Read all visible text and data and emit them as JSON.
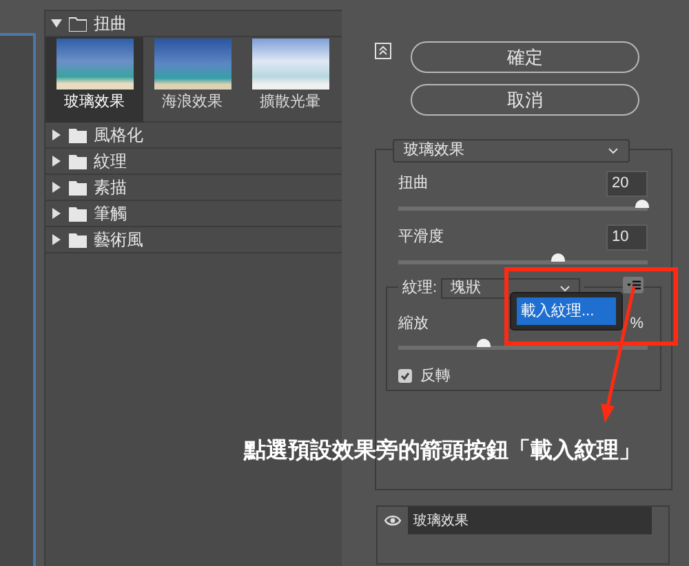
{
  "gallery": {
    "categories": [
      {
        "label": "扭曲",
        "expanded": true,
        "filters": [
          {
            "label": "玻璃效果",
            "selected": true
          },
          {
            "label": "海浪效果",
            "selected": false
          },
          {
            "label": "擴散光暈",
            "selected": false
          }
        ]
      },
      {
        "label": "風格化",
        "expanded": false
      },
      {
        "label": "紋理",
        "expanded": false
      },
      {
        "label": "素描",
        "expanded": false
      },
      {
        "label": "筆觸",
        "expanded": false
      },
      {
        "label": "藝術風",
        "expanded": false
      }
    ]
  },
  "buttons": [
    {
      "label": "確定"
    },
    {
      "label": "取消"
    }
  ],
  "filter_select": {
    "value": "玻璃效果"
  },
  "sliders": [
    {
      "label": "扭曲",
      "value": "20",
      "level": 0.98
    },
    {
      "label": "平滑度",
      "value": "10",
      "level": 0.64
    }
  ],
  "texture": {
    "label": "紋理:",
    "value": "塊狀",
    "scaling": {
      "label": "縮放",
      "unit": "%",
      "level": 0.34
    },
    "invert": {
      "label": "反轉",
      "checked": true
    }
  },
  "popup_menu": {
    "items": [
      {
        "label": "載入紋理...",
        "selected": true
      }
    ]
  },
  "annotation": {
    "text": "點選預設效果旁的箭頭按鈕「載入紋理」"
  },
  "effect_layers": [
    {
      "label": "玻璃效果",
      "visible": true
    }
  ]
}
